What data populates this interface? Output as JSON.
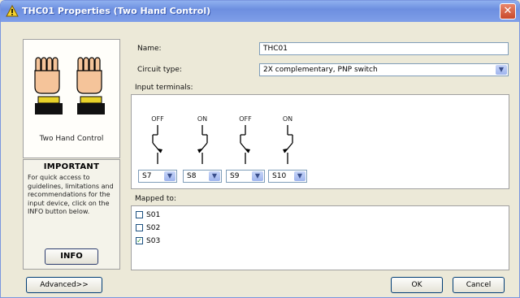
{
  "window": {
    "title": "THC01 Properties (Two Hand Control)"
  },
  "left_panel": {
    "device_label": "Two Hand Control",
    "important_title": "IMPORTANT",
    "important_text": "For quick access to guidelines, limitations and recommendations for the input device, click on the INFO button below.",
    "info_button": "INFO"
  },
  "form": {
    "name_label": "Name:",
    "name_value": "THC01",
    "circuit_label": "Circuit type:",
    "circuit_value": "2X complementary, PNP switch",
    "input_terminals_label": "Input terminals:",
    "mapped_to_label": "Mapped to:"
  },
  "terminals": [
    {
      "state": "OFF",
      "value": "S7"
    },
    {
      "state": "ON",
      "value": "S8"
    },
    {
      "state": "OFF",
      "value": "S9"
    },
    {
      "state": "ON",
      "value": "S10"
    }
  ],
  "mapped_to": [
    {
      "label": "S01",
      "checked": false
    },
    {
      "label": "S02",
      "checked": false
    },
    {
      "label": "S03",
      "checked": true
    }
  ],
  "buttons": {
    "advanced": "Advanced>>",
    "ok": "OK",
    "cancel": "Cancel"
  },
  "colors": {
    "titlebar": "#7f9ee8",
    "dialog_bg": "#ece9d8",
    "hand_skin": "#f5c49a",
    "button_yellow": "#e8d22a"
  }
}
